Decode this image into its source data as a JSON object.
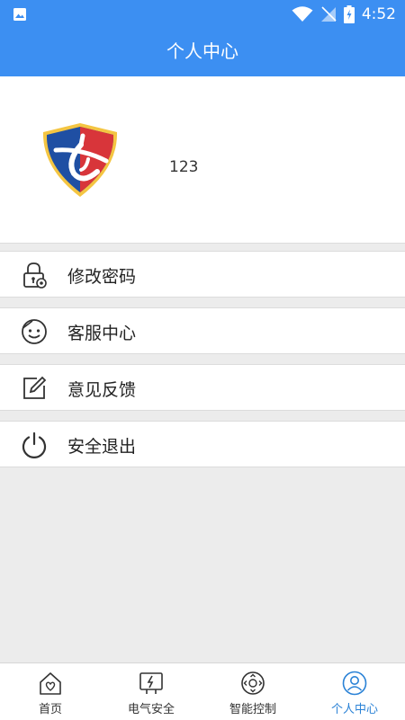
{
  "status_bar": {
    "time": "4:52"
  },
  "header": {
    "title": "个人中心"
  },
  "profile": {
    "username": "123"
  },
  "menu": [
    {
      "label": "修改密码",
      "icon": "lock-gear-icon"
    },
    {
      "label": "客服中心",
      "icon": "smiley-face-icon"
    },
    {
      "label": "意见反馈",
      "icon": "edit-pencil-icon"
    },
    {
      "label": "安全退出",
      "icon": "power-icon"
    }
  ],
  "bottom_nav": [
    {
      "label": "首页",
      "icon": "home-icon"
    },
    {
      "label": "电气安全",
      "icon": "electric-icon"
    },
    {
      "label": "智能控制",
      "icon": "control-icon"
    },
    {
      "label": "个人中心",
      "icon": "user-icon",
      "active": true
    }
  ],
  "colors": {
    "accent": "#3c8ff2",
    "active_tab": "#2a82d6"
  }
}
